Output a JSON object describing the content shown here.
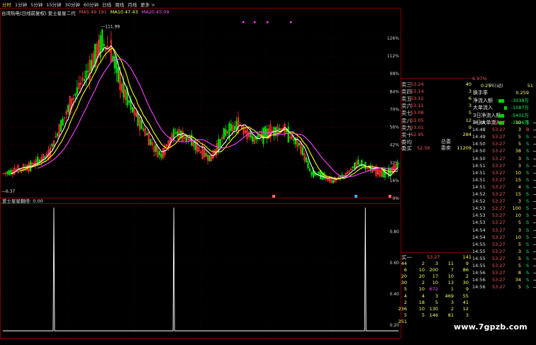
{
  "periods": [
    "分时",
    "1分钟",
    "5分钟",
    "15分钟",
    "30分钟",
    "60分钟",
    "日线",
    "周线",
    "月线",
    "更多 >"
  ],
  "active_period": 0,
  "legend": {
    "title": "台湾热电(日线前复权) 爱士星星二代",
    "ma5": "MA5 49.191",
    "ma10": "MA10 47.43",
    "ma20": "MA20 45.09"
  },
  "colors": {
    "up": "#ff3333",
    "down": "#00dd00",
    "ma5": "#ffffff",
    "ma10": "#ffff00",
    "ma20": "#ff44ff",
    "grid": "#7a0000",
    "text": "#cfcfcf"
  },
  "price_labels": [
    {
      "text": "—111.99",
      "price": 111.99
    },
    {
      "text": "—6.37",
      "price": 6.37
    }
  ],
  "right_pct_axis": [
    "126%",
    "112%",
    "98%",
    "84%",
    "70%",
    "56%",
    "42%",
    "32%",
    "16%",
    "0%"
  ],
  "indicator": {
    "label": "爱士星星翻倍: 0.00",
    "axis": [
      "0.80",
      "0.60",
      "0.40",
      "0.20"
    ]
  },
  "chart_data": {
    "type": "candlestick",
    "ma_periods": [
      5,
      10,
      20
    ],
    "indicator_spikes_at_index": [
      9,
      30,
      64
    ],
    "ohlc": []
  },
  "orderbook": {
    "sell": [
      {
        "label": "卖三",
        "price": "53.24",
        "vol": "40"
      },
      {
        "label": "卖四",
        "price": "53.14",
        "vol": "3"
      },
      {
        "label": "卖五",
        "price": "53.12",
        "vol": "6"
      },
      {
        "label": "卖六",
        "price": "53.11",
        "vol": "3"
      },
      {
        "label": "卖七",
        "price": "53.08",
        "vol": "5"
      },
      {
        "label": "卖八",
        "price": "53.05",
        "vol": "12"
      },
      {
        "label": "卖九",
        "price": "53.01",
        "vol": "9"
      },
      {
        "label": "卖十",
        "price": "52.95",
        "vol": "284"
      }
    ],
    "avg_label": "委均",
    "total_label": "总委",
    "total_val": "11209",
    "summary_label": "委买",
    "summary_price": "52.56",
    "summary_end": "委卖",
    "buy_label": "买一",
    "buy_price": "53.27",
    "buy_vol": "141"
  },
  "flow_panel": {
    "header": [
      "6.97%",
      "0.25",
      "PE(动)",
      "51"
    ],
    "rows": [
      {
        "label": "换手率",
        "val": "0.259"
      },
      {
        "label": "净流入额",
        "val": "-3038万"
      },
      {
        "label": "大单流入",
        "val": "-1587万"
      },
      {
        "label": "3日净流入额",
        "val": "-5401万"
      },
      {
        "label": "3日大单流入",
        "val": "-3326万"
      }
    ]
  },
  "ticks": [
    {
      "t": "14:48",
      "p": "53.27",
      "v": "10",
      "d": "S"
    },
    {
      "t": "14:48",
      "p": "53.27",
      "v": "3",
      "d": "B"
    },
    {
      "t": "14:49",
      "p": "53.27",
      "v": "5",
      "d": "S"
    },
    {
      "t": "14:50",
      "p": "53.27",
      "v": "5",
      "d": "S"
    },
    {
      "t": "14:50",
      "p": "53.27",
      "v": "38",
      "d": "S"
    },
    {
      "t": "14:50",
      "p": "53.27",
      "v": "3",
      "d": "S"
    },
    {
      "t": "14:51",
      "p": "53.27",
      "v": "3",
      "d": "S"
    },
    {
      "t": "14:51",
      "p": "53.27",
      "v": "10",
      "d": "S"
    },
    {
      "t": "14:51",
      "p": "53.27",
      "v": "15",
      "d": "S"
    },
    {
      "t": "14:51",
      "p": "53.27",
      "v": "4",
      "d": "S"
    },
    {
      "t": "14:52",
      "p": "53.27",
      "v": "15",
      "d": "S"
    },
    {
      "t": "14:52",
      "p": "53.27",
      "v": "3",
      "d": "S"
    },
    {
      "t": "14:53",
      "p": "53.27",
      "v": "100",
      "d": "S"
    },
    {
      "t": "14:53",
      "p": "53.27",
      "v": "10",
      "d": "S"
    },
    {
      "t": "14:53",
      "p": "53.27",
      "v": "5",
      "d": "S"
    },
    {
      "t": "14:54",
      "p": "53.27",
      "v": "3",
      "d": "S"
    },
    {
      "t": "14:54",
      "p": "53.27",
      "v": "10",
      "d": "S"
    },
    {
      "t": "14:55",
      "p": "53.27",
      "v": "5",
      "d": "S"
    },
    {
      "t": "14:55",
      "p": "53.27",
      "v": "3",
      "d": "S"
    },
    {
      "t": "14:55",
      "p": "53.27",
      "v": "5",
      "d": "S"
    },
    {
      "t": "14:55",
      "p": "53.27",
      "v": "5",
      "d": "S"
    },
    {
      "t": "14:56",
      "p": "53.27",
      "v": "8",
      "d": "S"
    },
    {
      "t": "14:56",
      "p": "53.27",
      "v": "34",
      "d": "S"
    },
    {
      "t": "14:56",
      "p": "53.27",
      "v": "5",
      "d": "S"
    }
  ],
  "lower_grid": [
    [
      "44",
      "2",
      "3",
      "11",
      "9"
    ],
    [
      "6",
      "10",
      "200",
      "7",
      "86"
    ],
    [
      "20",
      "20",
      "17",
      "10",
      "2"
    ],
    [
      "30",
      "2",
      "10",
      "13",
      "30"
    ],
    [
      "5",
      "10",
      "672",
      "1",
      "9"
    ],
    [
      "4",
      "4",
      "3",
      "469",
      "55"
    ],
    [
      "2",
      "18",
      "5",
      "3",
      "41"
    ],
    [
      "236",
      "10",
      "130",
      "2",
      "12"
    ],
    [
      "5",
      "5",
      "146",
      "81",
      "3"
    ],
    [
      "251",
      "",
      "",
      "",
      ""
    ]
  ],
  "watermark": "www.7gpzb.com"
}
